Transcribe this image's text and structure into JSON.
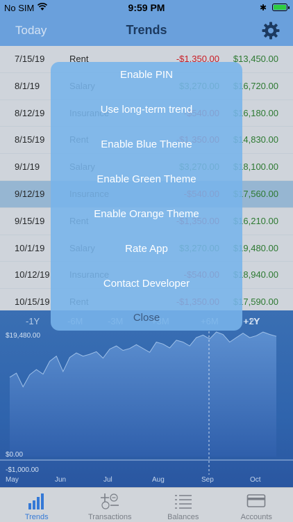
{
  "status": {
    "carrier": "No SIM",
    "time": "9:59 PM",
    "bluetooth": "✱"
  },
  "nav": {
    "left": "Today",
    "title": "Trends"
  },
  "rows": [
    {
      "date": "7/15/19",
      "category": "Rent",
      "amount": "-$1,350.00",
      "amount_sign": "neg",
      "balance": "$13,450.00"
    },
    {
      "date": "8/1/19",
      "category": "Salary",
      "amount": "$3,270.00",
      "amount_sign": "pos",
      "balance": "$16,720.00"
    },
    {
      "date": "8/12/19",
      "category": "Insurance",
      "amount": "-$540.00",
      "amount_sign": "neg",
      "balance": "$16,180.00"
    },
    {
      "date": "8/15/19",
      "category": "Rent",
      "amount": "-$1,350.00",
      "amount_sign": "neg",
      "balance": "$14,830.00"
    },
    {
      "date": "9/1/19",
      "category": "Salary",
      "amount": "$3,270.00",
      "amount_sign": "pos",
      "balance": "$18,100.00"
    },
    {
      "date": "9/12/19",
      "category": "Insurance",
      "amount": "-$540.00",
      "amount_sign": "neg",
      "balance": "$17,560.00",
      "selected": true
    },
    {
      "date": "9/15/19",
      "category": "Rent",
      "amount": "-$1,350.00",
      "amount_sign": "neg",
      "balance": "$16,210.00"
    },
    {
      "date": "10/1/19",
      "category": "Salary",
      "amount": "$3,270.00",
      "amount_sign": "pos",
      "balance": "$19,480.00"
    },
    {
      "date": "10/12/19",
      "category": "Insurance",
      "amount": "-$540.00",
      "amount_sign": "neg",
      "balance": "$18,940.00"
    },
    {
      "date": "10/15/19",
      "category": "Rent",
      "amount": "-$1,350.00",
      "amount_sign": "neg",
      "balance": "$17,590.00"
    }
  ],
  "range_buttons": [
    "-1Y",
    "-6M",
    "-3M",
    "+3M",
    "+6M",
    "+1Y",
    "+2Y"
  ],
  "chart_data": {
    "type": "area",
    "y_labels": [
      "$19,480.00",
      "$0.00",
      "-$1,000.00"
    ],
    "x_labels": [
      "May",
      "Jun",
      "Jul",
      "Aug",
      "Sep",
      "Oct"
    ],
    "ylim": [
      -1000,
      19480
    ],
    "values": [
      12400,
      13050,
      10900,
      12800,
      13600,
      12900,
      14900,
      15700,
      13300,
      15500,
      16200,
      15700,
      16000,
      16400,
      15400,
      16800,
      17300,
      16600,
      16900,
      17500,
      16900,
      16300,
      17900,
      17600,
      17000,
      18200,
      17900,
      17300,
      18600,
      19000,
      18400,
      19480,
      19100,
      17900,
      18600,
      19300,
      18600,
      18900,
      19480,
      19100,
      18800
    ]
  },
  "tabs": [
    {
      "label": "Trends",
      "icon": "bar-chart-icon",
      "active": true
    },
    {
      "label": "Transactions",
      "icon": "plus-minus-icon"
    },
    {
      "label": "Balances",
      "icon": "list-icon"
    },
    {
      "label": "Accounts",
      "icon": "card-icon"
    }
  ],
  "menu": {
    "items": [
      "Enable PIN",
      "Use long-term trend",
      "Enable Blue Theme",
      "Enable Green Theme",
      "Enable Orange Theme",
      "Rate App",
      "Contact Developer"
    ],
    "close": "Close"
  }
}
